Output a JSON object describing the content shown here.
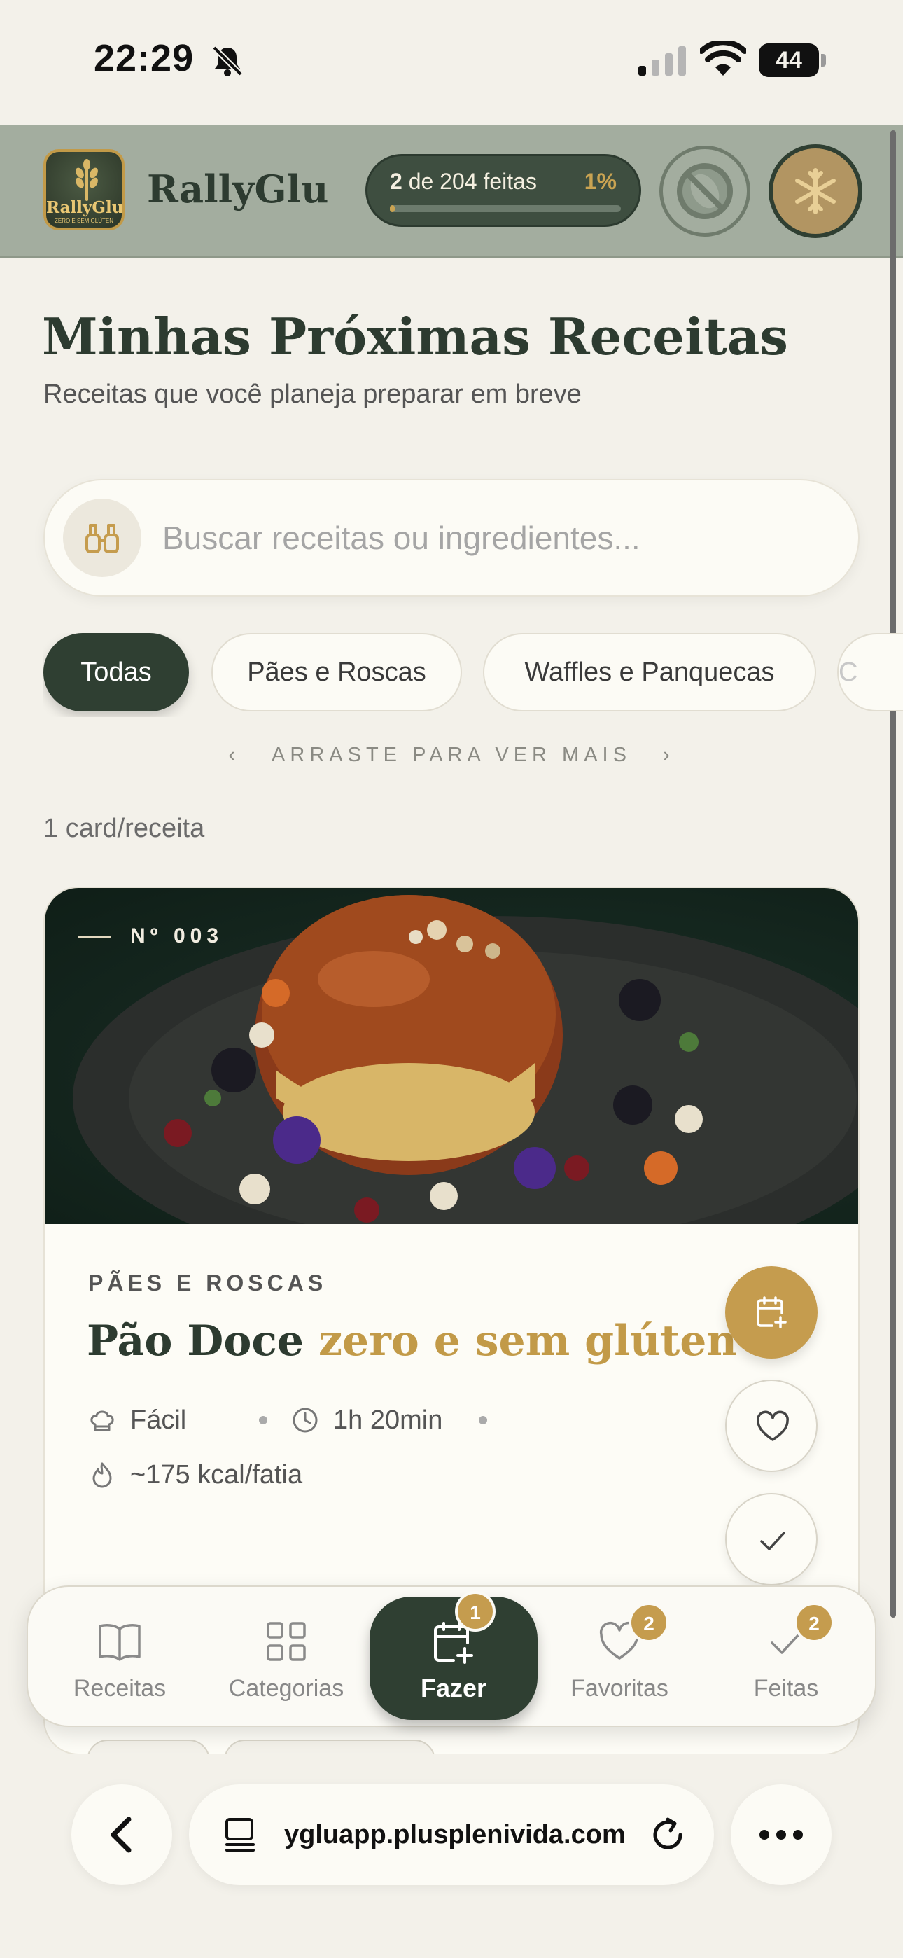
{
  "status_bar": {
    "time": "22:29",
    "battery": "44",
    "battery_level": 0.44
  },
  "header": {
    "brand": "RallyGlu",
    "logo_text": "RallyGlu",
    "logo_subtext": "ZERO E SEM GLÚTEN",
    "progress_done": "2",
    "progress_text": "de 204 feitas",
    "progress_percent": "1%",
    "progress_fraction": 0.01
  },
  "page": {
    "title": "Minhas Próximas Receitas",
    "subtitle": "Receitas que você planeja preparar em breve"
  },
  "search": {
    "placeholder": "Buscar receitas ou ingredientes..."
  },
  "chips": [
    "Todas",
    "Pães e Roscas",
    "Waffles e Panquecas",
    "C"
  ],
  "swipe_hint": "ARRASTE PARA VER MAIS",
  "per_card_label": "1 card/receita",
  "recipe": {
    "number": "Nº 003",
    "category": "PÃES E ROSCAS",
    "title_main": "Pão Doce",
    "title_accent": "zero e sem glúten",
    "difficulty": "Fácil",
    "time": "1h 20min",
    "calories": "~175 kcal/fatia"
  },
  "nav": {
    "items": [
      {
        "label": "Receitas",
        "icon": "book-icon"
      },
      {
        "label": "Categorias",
        "icon": "grid-icon"
      },
      {
        "label": "Fazer",
        "icon": "calendar-plus-icon",
        "badge": "1"
      },
      {
        "label": "Favoritas",
        "icon": "heart-icon",
        "badge": "2"
      },
      {
        "label": "Feitas",
        "icon": "check-icon",
        "badge": "2"
      }
    ]
  },
  "browser": {
    "url": "ygluapp.plusplenivida.com"
  },
  "colors": {
    "primary": "#2f3f32",
    "accent": "#c59c4e",
    "background": "#f3f1ea",
    "header": "#a3ad9f"
  }
}
